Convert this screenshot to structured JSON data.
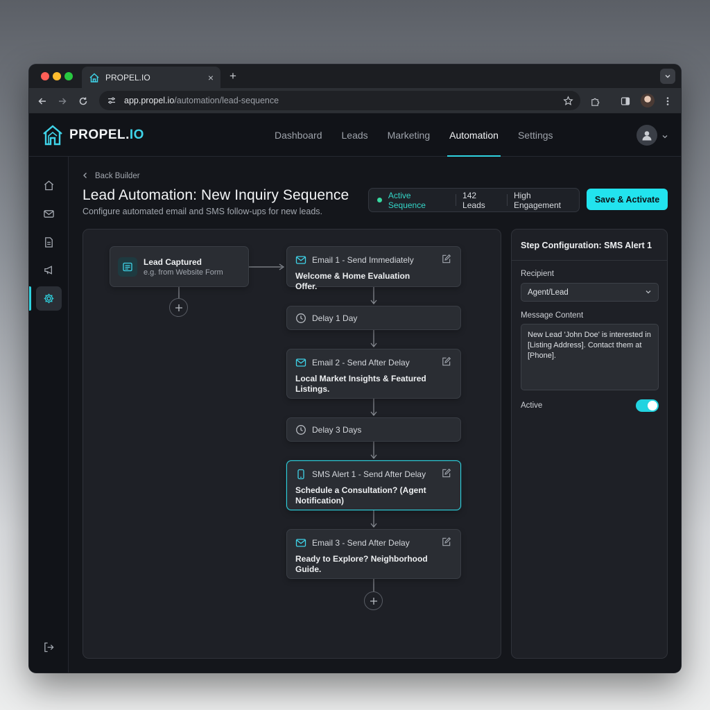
{
  "browser": {
    "tab_title": "PROPEL.IO",
    "tab_close": "×",
    "new_tab": "+",
    "url_host": "app.propel.io",
    "url_path": "/automation/lead-sequence"
  },
  "brand": {
    "name_main": "PROPEL.",
    "name_accent": "IO",
    "accent_color": "#2fd3e0"
  },
  "nav": {
    "items": [
      {
        "label": "Dashboard",
        "active": false
      },
      {
        "label": "Leads",
        "active": false
      },
      {
        "label": "Marketing",
        "active": false
      },
      {
        "label": "Automation",
        "active": true
      },
      {
        "label": "Settings",
        "active": false
      }
    ]
  },
  "sidebar": {
    "items": [
      "home-icon",
      "mail-icon",
      "document-icon",
      "megaphone-icon",
      "gear-icon"
    ],
    "active": "gear-icon",
    "bottom": "logout-icon"
  },
  "page": {
    "back_label": "Back Builder",
    "title": "Lead Automation: New Inquiry Sequence",
    "subtitle": "Configure automated email and SMS follow-ups for new leads."
  },
  "status": {
    "active_label": "Active Sequence",
    "leads_label": "142 Leads",
    "engagement_label": "High Engagement",
    "dot_color": "#37d9a0"
  },
  "actions": {
    "save_label": "Save & Activate"
  },
  "flow": {
    "trigger": {
      "title": "Lead Captured",
      "subtitle": "e.g. from Website Form"
    },
    "steps": [
      {
        "kind": "email",
        "header": "Email 1 - Send Immediately",
        "body": "Welcome & Home Evaluation Offer."
      },
      {
        "kind": "delay",
        "header": "Delay 1 Day"
      },
      {
        "kind": "email",
        "header": "Email 2 - Send After Delay",
        "body": "Local Market Insights & Featured Listings."
      },
      {
        "kind": "delay",
        "header": "Delay 3 Days"
      },
      {
        "kind": "sms",
        "header": "SMS Alert 1 - Send After Delay",
        "body": "Schedule a Consultation? (Agent Notification)",
        "selected": true
      },
      {
        "kind": "email",
        "header": "Email 3 - Send After Delay",
        "body": "Ready to Explore? Neighborhood Guide."
      }
    ]
  },
  "config": {
    "title": "Step Configuration: SMS Alert 1",
    "recipient_label": "Recipient",
    "recipient_value": "Agent/Lead",
    "message_label": "Message Content",
    "message_value": "New Lead 'John Doe' is interested in [Listing Address]. Contact them at [Phone].",
    "active_label": "Active",
    "active": true
  }
}
